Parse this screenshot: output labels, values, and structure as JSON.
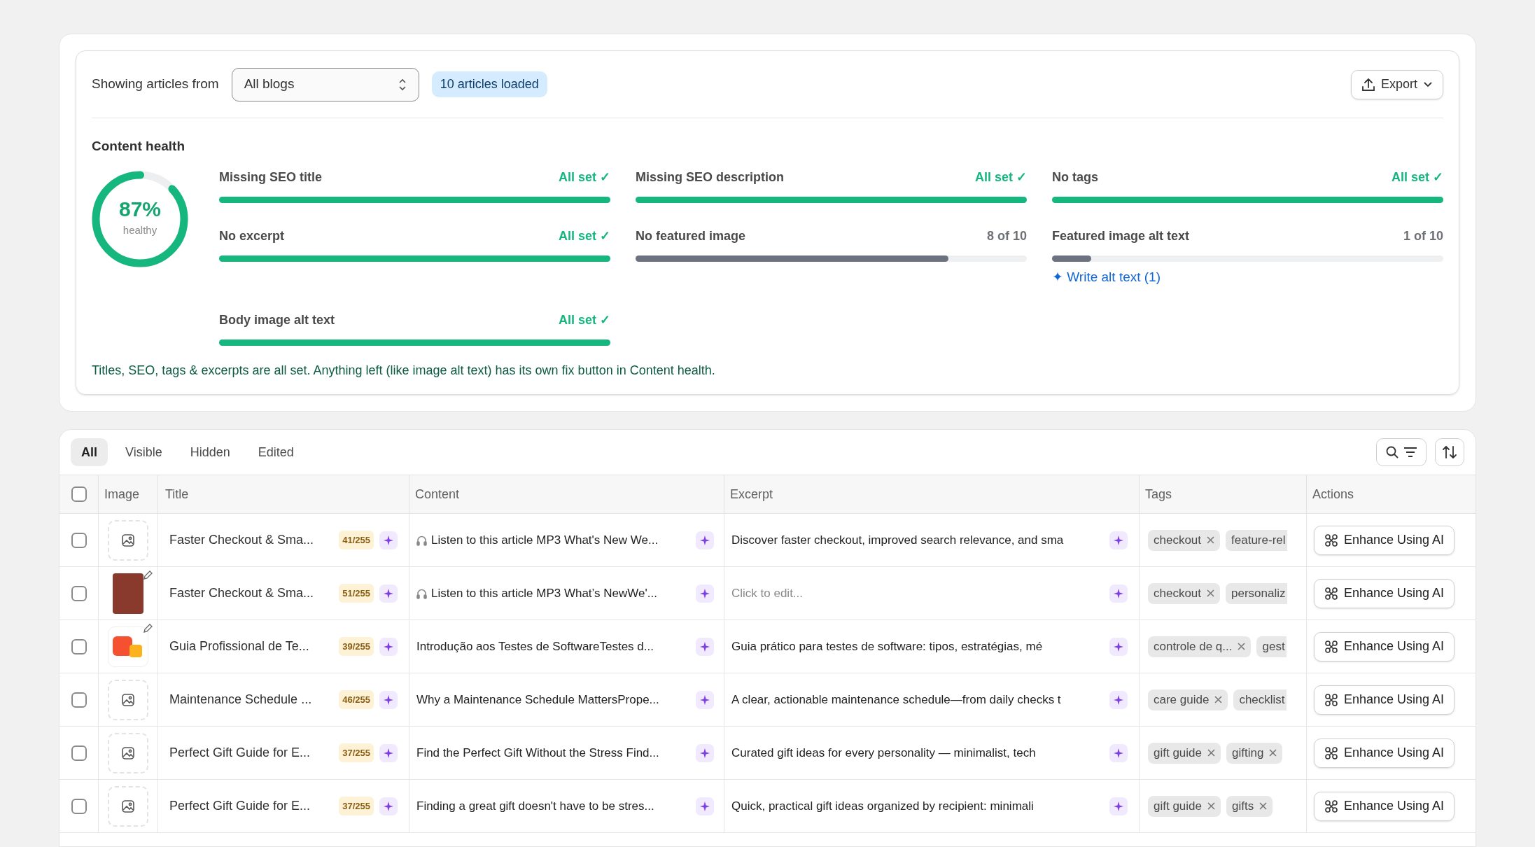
{
  "filter": {
    "label": "Showing articles from",
    "select_value": "All blogs",
    "badge": "10 articles loaded",
    "export_label": "Export"
  },
  "health": {
    "title": "Content health",
    "score": "87%",
    "score_caption": "healthy",
    "level": 0.87,
    "metrics": [
      {
        "label": "Missing SEO title",
        "status": "All set ✓",
        "kind": "ok",
        "level": 1
      },
      {
        "label": "Missing SEO description",
        "status": "All set ✓",
        "kind": "ok",
        "level": 1
      },
      {
        "label": "No tags",
        "status": "All set ✓",
        "kind": "ok",
        "level": 1
      },
      {
        "label": "No excerpt",
        "status": "All set ✓",
        "kind": "ok",
        "level": 1
      },
      {
        "label": "No featured image",
        "status": "8 of 10",
        "kind": "count",
        "level": 0.8
      },
      {
        "label": "Featured image alt text",
        "status": "1 of 10",
        "kind": "count",
        "level": 0.1,
        "action": "✦ Write alt text (1)"
      },
      {
        "label": "Body image alt text",
        "status": "All set ✓",
        "kind": "ok",
        "level": 1
      }
    ],
    "note": "Titles, SEO, tags & excerpts are all set. Anything left (like image alt text) has its own fix button in Content health."
  },
  "tabs": [
    {
      "label": "All",
      "selected": true
    },
    {
      "label": "Visible",
      "selected": false
    },
    {
      "label": "Hidden",
      "selected": false
    },
    {
      "label": "Edited",
      "selected": false
    }
  ],
  "table": {
    "select_all_checked": false,
    "columns": [
      "Image",
      "Title",
      "Content",
      "Excerpt",
      "Tags",
      "Actions"
    ],
    "rows": [
      {
        "checked": false,
        "image": {
          "kind": "empty"
        },
        "title": "Faster Checkout & Sma...",
        "count": "41/255",
        "audio": true,
        "content": "Listen to this article MP3 What's New We...",
        "excerpt": {
          "kind": "text",
          "text": "Discover faster checkout, improved search relevance, and sma"
        },
        "tags": [
          {
            "label": "checkout",
            "cut": false
          },
          {
            "label": "feature-rel",
            "cut": true
          }
        ],
        "action": "Enhance Using AI"
      },
      {
        "checked": false,
        "image": {
          "kind": "photo"
        },
        "title": "Faster Checkout & Sma...",
        "count": "51/255",
        "audio": true,
        "content": "Listen to this article MP3 What’s NewWe'...",
        "excerpt": {
          "kind": "placeholder",
          "text": "Click to edit..."
        },
        "tags": [
          {
            "label": "checkout",
            "cut": false
          },
          {
            "label": "personaliz",
            "cut": true
          }
        ],
        "action": "Enhance Using AI"
      },
      {
        "checked": false,
        "image": {
          "kind": "logo"
        },
        "title": "Guia Profissional de Te...",
        "count": "39/255",
        "audio": false,
        "content": "Introdução aos Testes de SoftwareTestes d...",
        "excerpt": {
          "kind": "text",
          "text": "Guia prático para testes de software: tipos, estratégias, mé"
        },
        "tags": [
          {
            "label": "controle de q...",
            "cut": false
          },
          {
            "label": "gest",
            "cut": true
          }
        ],
        "action": "Enhance Using AI"
      },
      {
        "checked": false,
        "image": {
          "kind": "empty"
        },
        "title": "Maintenance Schedule ...",
        "count": "46/255",
        "audio": false,
        "content": "Why a Maintenance Schedule MattersPrope...",
        "excerpt": {
          "kind": "text",
          "text": "A clear, actionable maintenance schedule—from daily checks t"
        },
        "tags": [
          {
            "label": "care guide",
            "cut": false
          },
          {
            "label": "checklist",
            "cut": true
          }
        ],
        "action": "Enhance Using AI"
      },
      {
        "checked": false,
        "image": {
          "kind": "empty"
        },
        "title": "Perfect Gift Guide for E...",
        "count": "37/255",
        "audio": false,
        "content": "Find the Perfect Gift Without the Stress Find...",
        "excerpt": {
          "kind": "text",
          "text": "Curated gift ideas for every personality — minimalist, tech"
        },
        "tags": [
          {
            "label": "gift guide",
            "cut": false
          },
          {
            "label": "gifting",
            "cut": false
          }
        ],
        "action": "Enhance Using AI"
      },
      {
        "checked": false,
        "image": {
          "kind": "empty"
        },
        "title": "Perfect Gift Guide for E...",
        "count": "37/255",
        "audio": false,
        "content": "Finding a great gift doesn't have to be stres...",
        "excerpt": {
          "kind": "text",
          "text": "Quick, practical gift ideas organized by recipient: minimali"
        },
        "tags": [
          {
            "label": "gift guide",
            "cut": false
          },
          {
            "label": "gifts",
            "cut": false
          }
        ],
        "action": "Enhance Using AI"
      }
    ]
  }
}
